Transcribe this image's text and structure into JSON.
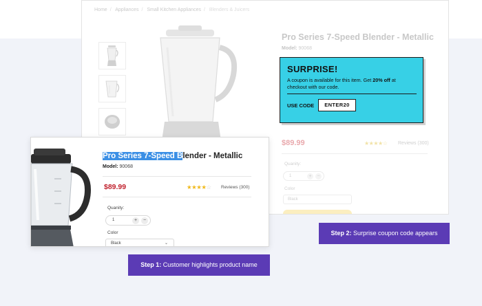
{
  "background_page": {
    "breadcrumb": [
      "Home",
      "Appliances",
      "Small Kitchen Appliances",
      "Blenders & Juicers"
    ],
    "product_title": "Pro Series 7-Speed Blender - Metallic",
    "model_label": "Model:",
    "model_number": "90068",
    "price": "$89.99",
    "stars": "★★★★☆",
    "reviews": "Reviews (300)",
    "quantity_label": "Quanity:",
    "quantity_value": "1",
    "color_label": "Color",
    "color_value": "Black"
  },
  "popup": {
    "title": "SURPRISE!",
    "body_before": "A coupon is available for this item. Get ",
    "body_highlight": "20% off",
    "body_after": " at checkout with our code.",
    "use_code_label": "USE CODE",
    "code": "ENTER20",
    "bg_color": "#37d0e6"
  },
  "card": {
    "title_highlighted": "Pro Series 7-Speed B",
    "title_rest": "lender - Metallic",
    "model_label": "Model:",
    "model_number": "90068",
    "price": "$89.99",
    "stars_on": "★★★★",
    "stars_off": "☆",
    "rating": 4,
    "reviews": "Reviews (300)",
    "quantity_label": "Quanity:",
    "quantity_value": "1",
    "plus": "+",
    "minus": "−",
    "color_label": "Color",
    "color_value": "Black",
    "highlight_color": "#3b8fe5",
    "price_color": "#c0202c"
  },
  "steps": {
    "step1_bold": "Step 1:",
    "step1_text": " Customer highlights product name",
    "step2_bold": "Step 2:",
    "step2_text": " Surprise coupon code appears",
    "color": "#5b3bb5"
  }
}
